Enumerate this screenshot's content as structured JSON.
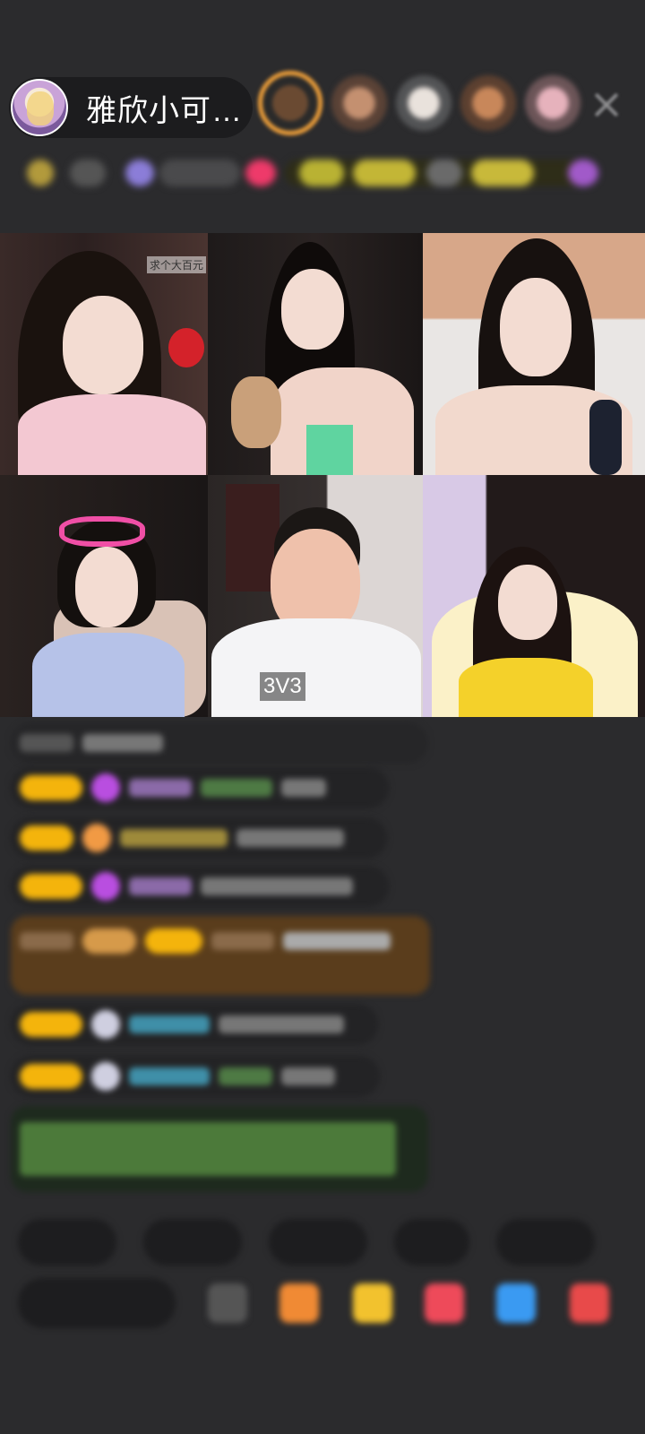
{
  "header": {
    "host_name": "雅欣小可…",
    "viewer_count": 5
  },
  "grid": {
    "cell_top_right_banner": "求个大百元",
    "mode_badge": "3V3"
  },
  "icons": {
    "avatar": "host-avatar",
    "close": "close-icon"
  },
  "colors": {
    "background": "#2b2b2d",
    "accent_gold": "#f4b40c",
    "accent_orange": "#f3a23a"
  }
}
